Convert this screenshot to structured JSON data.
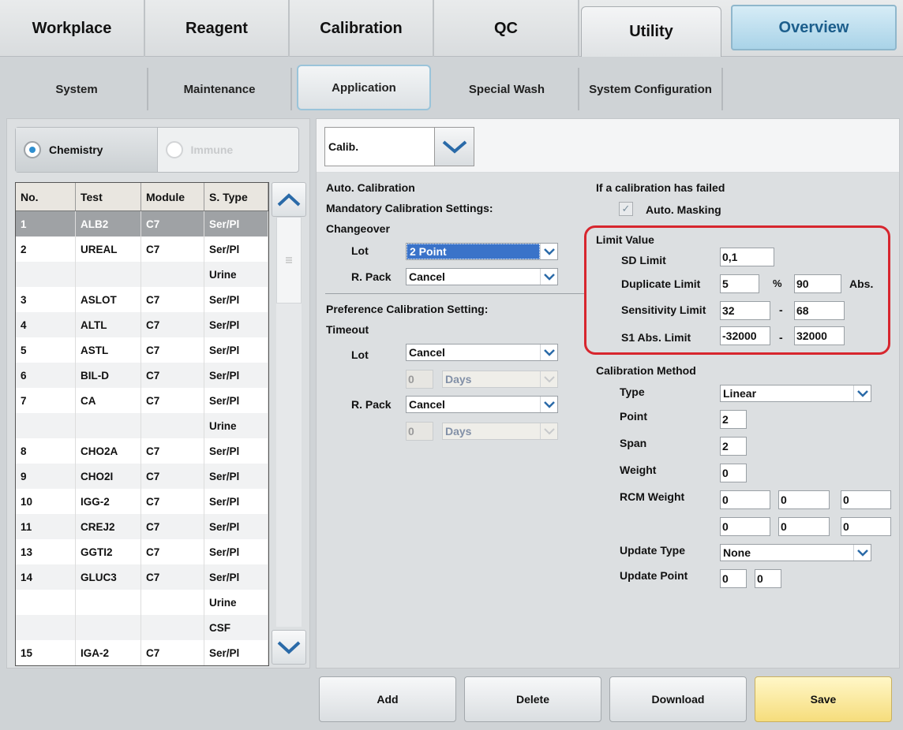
{
  "top_tabs": [
    {
      "label": "Workplace"
    },
    {
      "label": "Reagent"
    },
    {
      "label": "Calibration"
    },
    {
      "label": "QC"
    },
    {
      "label": "Utility",
      "active": true
    },
    {
      "label": "Overview"
    }
  ],
  "sub_tabs": [
    {
      "label": "System"
    },
    {
      "label": "Maintenance"
    },
    {
      "label": "Application",
      "active": true
    },
    {
      "label": "Special Wash"
    },
    {
      "label": "System Configuration"
    }
  ],
  "left": {
    "radio": {
      "chemistry": "Chemistry",
      "immune": "Immune",
      "selected": "chemistry"
    },
    "columns": [
      "No.",
      "Test",
      "Module",
      "S. Type"
    ],
    "rows": [
      {
        "no": "1",
        "test": "ALB2",
        "module": "C7",
        "stype": "Ser/Pl",
        "selected": true
      },
      {
        "no": "2",
        "test": "UREAL",
        "module": "C7",
        "stype": "Ser/Pl"
      },
      {
        "no": "",
        "test": "",
        "module": "",
        "stype": "Urine"
      },
      {
        "no": "3",
        "test": "ASLOT",
        "module": "C7",
        "stype": "Ser/Pl"
      },
      {
        "no": "4",
        "test": "ALTL",
        "module": "C7",
        "stype": "Ser/Pl"
      },
      {
        "no": "5",
        "test": "ASTL",
        "module": "C7",
        "stype": "Ser/Pl"
      },
      {
        "no": "6",
        "test": "BIL-D",
        "module": "C7",
        "stype": "Ser/Pl"
      },
      {
        "no": "7",
        "test": "CA",
        "module": "C7",
        "stype": "Ser/Pl"
      },
      {
        "no": "",
        "test": "",
        "module": "",
        "stype": "Urine"
      },
      {
        "no": "8",
        "test": "CHO2A",
        "module": "C7",
        "stype": "Ser/Pl"
      },
      {
        "no": "9",
        "test": "CHO2I",
        "module": "C7",
        "stype": "Ser/Pl"
      },
      {
        "no": "10",
        "test": "IGG-2",
        "module": "C7",
        "stype": "Ser/Pl"
      },
      {
        "no": "11",
        "test": "CREJ2",
        "module": "C7",
        "stype": "Ser/Pl"
      },
      {
        "no": "13",
        "test": "GGTI2",
        "module": "C7",
        "stype": "Ser/Pl"
      },
      {
        "no": "14",
        "test": "GLUC3",
        "module": "C7",
        "stype": "Ser/Pl"
      },
      {
        "no": "",
        "test": "",
        "module": "",
        "stype": "Urine"
      },
      {
        "no": "",
        "test": "",
        "module": "",
        "stype": "CSF"
      },
      {
        "no": "15",
        "test": "IGA-2",
        "module": "C7",
        "stype": "Ser/Pl"
      }
    ]
  },
  "right": {
    "category": "Calib.",
    "auto_calibration": "Auto. Calibration",
    "mandatory": "Mandatory Calibration Settings:",
    "changeover": "Changeover",
    "lot_label": "Lot",
    "lot_value": "2 Point",
    "rpack_label": "R. Pack",
    "rpack_value": "Cancel",
    "preference": "Preference Calibration Setting:",
    "timeout": "Timeout",
    "t_lot_label": "Lot",
    "t_lot_value": "Cancel",
    "t_lot_days_num": "0",
    "t_lot_days_unit": "Days",
    "t_rpack_label": "R. Pack",
    "t_rpack_value": "Cancel",
    "t_rpack_days_num": "0",
    "t_rpack_days_unit": "Days",
    "failed_title": "If a calibration has failed",
    "auto_masking": "Auto. Masking",
    "limit_title": "Limit Value",
    "sd_limit_label": "SD Limit",
    "sd_limit": "0,1",
    "dup_label": "Duplicate Limit",
    "dup_pct": "5",
    "pct_sign": "%",
    "dup_abs": "90",
    "abs_label": "Abs.",
    "sens_label": "Sensitivity Limit",
    "sens_low": "32",
    "sens_high": "68",
    "dash": "-",
    "s1_label": "S1 Abs. Limit",
    "s1_low": "-32000",
    "s1_high": "32000",
    "method_title": "Calibration Method",
    "type_label": "Type",
    "type_value": "Linear",
    "point_label": "Point",
    "point_value": "2",
    "span_label": "Span",
    "span_value": "2",
    "weight_label": "Weight",
    "weight_value": "0",
    "rcm_label": "RCM Weight",
    "rcm": [
      "0",
      "0",
      "0",
      "0",
      "0",
      "0"
    ],
    "update_type_label": "Update Type",
    "update_type_value": "None",
    "update_point_label": "Update Point",
    "update_point": [
      "0",
      "0"
    ]
  },
  "buttons": {
    "add": "Add",
    "delete": "Delete",
    "download": "Download",
    "save": "Save"
  },
  "colors": {
    "accent_blue": "#2f8fd0",
    "highlight_red": "#d7262e",
    "save_yellow": "#f6dd7c",
    "overview_text": "#1c5e8c"
  }
}
